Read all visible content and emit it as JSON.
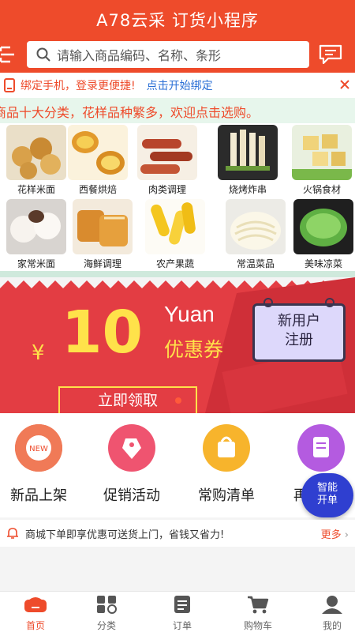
{
  "header": {
    "title": "A78云采 订货小程序",
    "search_placeholder": "请输入商品编码、名称、条形"
  },
  "bind_bar": {
    "text": "绑定手机，登录更便捷!",
    "link": "点击开始绑定"
  },
  "marquee": {
    "text": "商品十大分类，花样品种繁多，欢迎点击选购。"
  },
  "categories": [
    {
      "label": "花样米面"
    },
    {
      "label": "西餐烘焙"
    },
    {
      "label": "肉类调理"
    },
    {
      "label": "烧烤炸串"
    },
    {
      "label": "火锅食材"
    },
    {
      "label": "家常米面"
    },
    {
      "label": "海鲜调理"
    },
    {
      "label": "农产果蔬"
    },
    {
      "label": "常温菜品"
    },
    {
      "label": "美味凉菜"
    }
  ],
  "banner": {
    "currency": "¥",
    "amount": "10",
    "unit": "Yuan",
    "coupon": "优惠券",
    "tag": "新用户\n注册",
    "claim": "立即领取"
  },
  "quick_entries": [
    {
      "label": "新品上架",
      "badge": "NEW"
    },
    {
      "label": "促销活动"
    },
    {
      "label": "常购清单"
    },
    {
      "label": "再"
    }
  ],
  "smart_order": "智能\n开单",
  "notice": {
    "text": "商城下单即享优惠可送货上门，省钱又省力!",
    "more": "更多"
  },
  "tabs": [
    {
      "label": "首页",
      "active": true
    },
    {
      "label": "分类"
    },
    {
      "label": "订单"
    },
    {
      "label": "购物车"
    },
    {
      "label": "我的"
    }
  ],
  "colors": {
    "brand": "#ee4b2b",
    "banner": "#e33d43",
    "accent_yellow": "#ffe24a",
    "link": "#2a6fd6"
  }
}
